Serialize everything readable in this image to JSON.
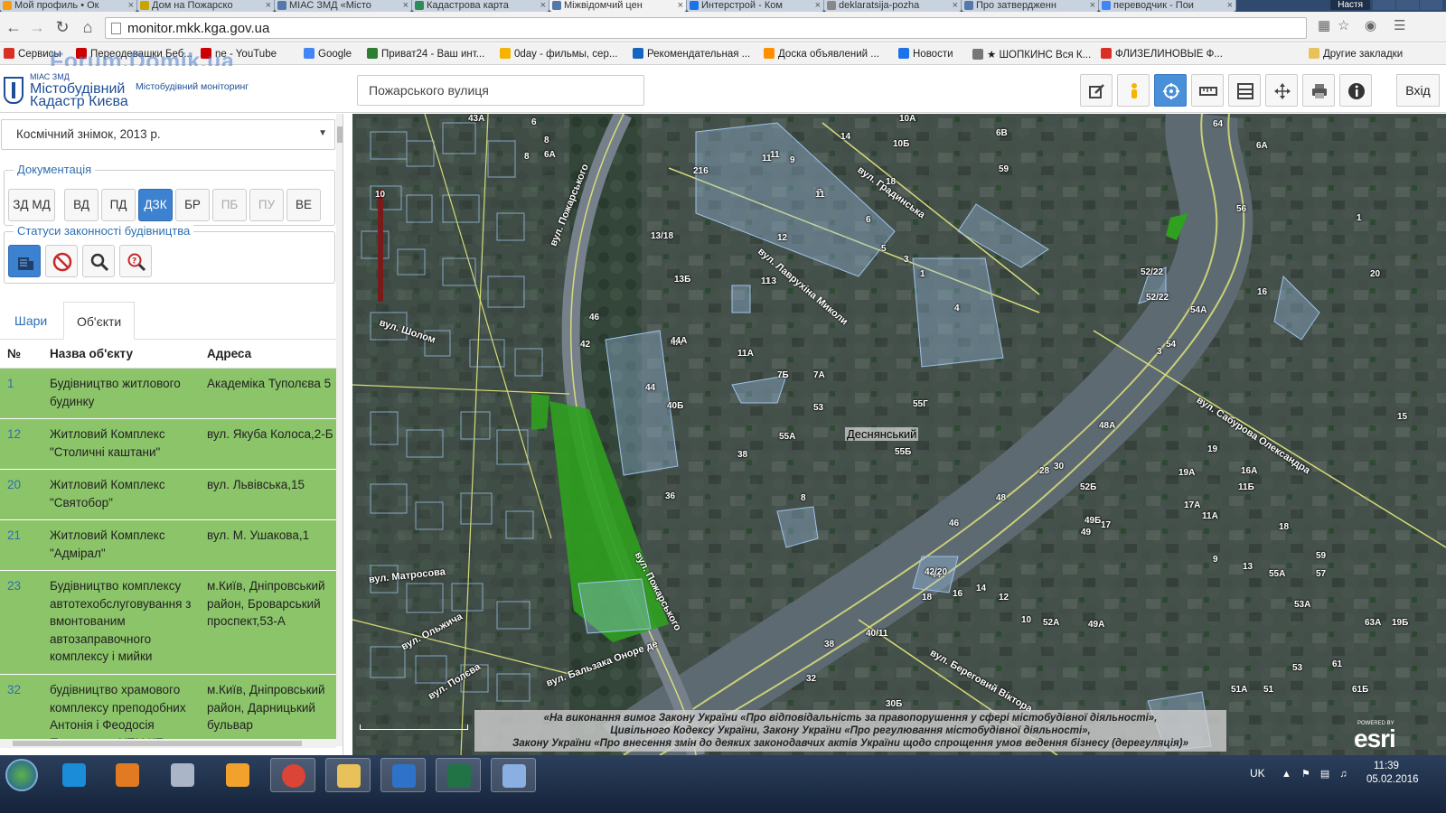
{
  "tabs": [
    {
      "label": "Мой профиль • Ок",
      "color": "#f39c12"
    },
    {
      "label": "Дом на Пожарско",
      "color": "#c8a400"
    },
    {
      "label": "МІАС ЗМД «Місто",
      "color": "#5577aa"
    },
    {
      "label": "Кадастрова карта",
      "color": "#2e8b57"
    },
    {
      "label": "Міжвідомчий цен",
      "color": "#5577aa"
    },
    {
      "label": "Интерстрой - Ком",
      "color": "#1a73e8"
    },
    {
      "label": "deklaratsija-pozha",
      "color": "#888888"
    },
    {
      "label": "Про затвердженн",
      "color": "#5577aa"
    },
    {
      "label": "переводчик - Пои",
      "color": "#4285f4"
    }
  ],
  "window_user": "Настя",
  "url": "monitor.mkk.kga.gov.ua",
  "bookmarks": [
    {
      "label": "Сервисы",
      "color": "#d93025"
    },
    {
      "label": "Переодевашки Беб...",
      "color": "#cc0000"
    },
    {
      "label": "ne - YouTube",
      "color": "#cc0000"
    },
    {
      "label": "Google",
      "color": "#4285f4"
    },
    {
      "label": "Приват24 - Ваш инт...",
      "color": "#2e7d32"
    },
    {
      "label": "0day - фильмы, сер...",
      "color": "#f4b400"
    },
    {
      "label": "Рекомендательная ...",
      "color": "#1565c0"
    },
    {
      "label": "Доска объявлений ...",
      "color": "#ff8f00"
    },
    {
      "label": "Новости",
      "color": "#1a73e8"
    },
    {
      "label": "★ ШОПКИНС Вся К...",
      "color": "#777777"
    },
    {
      "label": "ФЛИЗЕЛИНОВЫЕ Ф...",
      "color": "#d93025"
    }
  ],
  "bookmarks_other": "Другие закладки",
  "watermark": "Forum.Domik.ua",
  "logo": {
    "small": "МІАС ЗМД",
    "line1": "Містобудівний",
    "line2": "Кадастр Києва",
    "sub": "Містобудівний моніторинг"
  },
  "search": {
    "value": "Пожарського вулиця"
  },
  "login_label": "Вхід",
  "basemap": "Космічний знімок, 2013 р.",
  "documentation": {
    "legend": "Документація",
    "buttons": [
      "ЗД МД",
      "ВД",
      "ПД",
      "ДЗК",
      "БР",
      "ПБ",
      "ПУ",
      "ВЕ"
    ],
    "active": "ДЗК"
  },
  "statuses_legend": "Статуси законності будівництва",
  "subtabs": [
    "Шари",
    "Об'єкти"
  ],
  "active_subtab": "Об'єкти",
  "table": {
    "headers": [
      "№",
      "Назва об'єкту",
      "Адреса"
    ],
    "rows": [
      {
        "num": "1",
        "name": "Будівництво житлового будинку",
        "addr": "Академіка Туполєва 5"
      },
      {
        "num": "12",
        "name": "Житловий Комплекс \"Столичні каштани\"",
        "addr": "вул. Якуба Колоса,2-Б"
      },
      {
        "num": "20",
        "name": "Житловий Комплекс \"Святобор\"",
        "addr": "вул. Львівська,15"
      },
      {
        "num": "21",
        "name": "Житловий Комплекс \"Адмірал\"",
        "addr": "вул. М. Ушакова,1"
      },
      {
        "num": "23",
        "name": "Будівництво комплексу автотехобслуговування з вмонтованим автозаправочного комплексу і мийки",
        "addr": "м.Київ, Дніпровський район, Броварський проспект,53-А"
      },
      {
        "num": "32",
        "name": "будівництво храмового комплексу преподобних Антонія і Феодосія Печерських УПЦ КП",
        "addr": "м.Київ, Дніпровський район, Дарницький бульвар"
      }
    ]
  },
  "map": {
    "district": "Деснянський",
    "streets": [
      {
        "text": "вул. Пожарського"
      },
      {
        "text": "вул. Градинська"
      },
      {
        "text": "вул. Лаврухіна Миколи"
      },
      {
        "text": "вул. Сабурова Олександра"
      },
      {
        "text": "вул. Пожарського"
      },
      {
        "text": "вул. Бальзака Оноре де"
      },
      {
        "text": "вул. Береговий Віктора"
      },
      {
        "text": "вул. Матросова"
      },
      {
        "text": "вул. Шолом"
      },
      {
        "text": "вул. Полєва"
      },
      {
        "text": "вул. Ольжича"
      }
    ],
    "house_labels": [
      "10",
      "43А",
      "6",
      "8",
      "6А",
      "8",
      "64",
      "6А",
      "10А",
      "6В",
      "56",
      "14",
      "10Б",
      "59",
      "11",
      "9",
      "7",
      "11",
      "6",
      "5",
      "3",
      "1",
      "4",
      "18",
      "216",
      "12",
      "11",
      "13",
      "13/18",
      "13Б",
      "11",
      "44",
      "4А",
      "7Б",
      "7А",
      "8",
      "11А",
      "40Б",
      "42",
      "46",
      "44А",
      "36",
      "38",
      "55А",
      "55Б",
      "55Г",
      "53",
      "54",
      "52/22",
      "52/22",
      "54А",
      "30",
      "28",
      "48",
      "46",
      "44",
      "42/20",
      "40/11",
      "38",
      "32",
      "30Б",
      "18",
      "16",
      "14",
      "12",
      "10",
      "52А",
      "52Б",
      "48А",
      "49Б",
      "49",
      "49А",
      "51А",
      "51",
      "53",
      "53А",
      "55А",
      "57",
      "59",
      "61",
      "61Б",
      "63А",
      "19Б",
      "15",
      "17",
      "17А",
      "19",
      "19А",
      "11А",
      "11Б",
      "9",
      "13",
      "16А",
      "18",
      "20",
      "16",
      "3",
      "1"
    ],
    "disclaimer": [
      "«На виконання вимог Закону України «Про відповідальність за правопорушення у сфері містобудівної діяльності»,",
      "Цивільного Кодексу України, Закону України «Про регулювання містобудівної діяльності»,",
      "Закону України «Про внесення змін до деяких законодавчих актів України щодо спрощення умов ведення бізнесу (дерегуляція)»"
    ],
    "esri_small": "POWERED BY",
    "esri": "esri"
  },
  "taskbar": {
    "lang": "UK",
    "time": "11:39",
    "date": "05.02.2016",
    "apps": [
      {
        "name": "ie",
        "color": "#1a8cd8"
      },
      {
        "name": "media-player",
        "color": "#e07b22"
      },
      {
        "name": "calculator",
        "color": "#aab6c8"
      },
      {
        "name": "app-orange",
        "color": "#f2a12c"
      },
      {
        "name": "chrome",
        "color": "#db4437"
      },
      {
        "name": "explorer",
        "color": "#e8c15a"
      },
      {
        "name": "lync",
        "color": "#2e73c9"
      },
      {
        "name": "excel",
        "color": "#217346"
      },
      {
        "name": "paint",
        "color": "#89b0e0"
      }
    ]
  }
}
